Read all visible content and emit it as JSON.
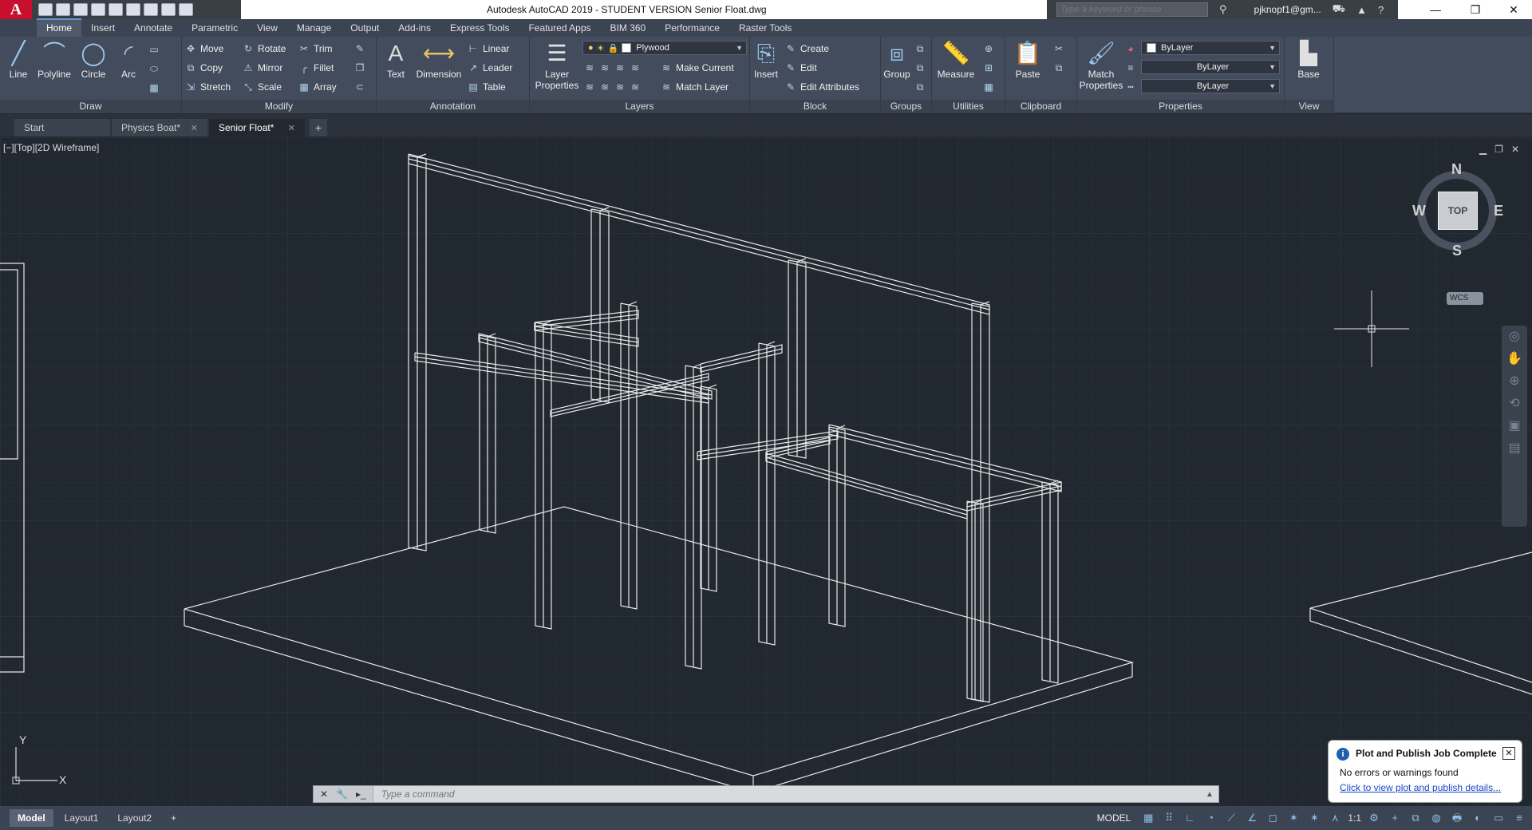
{
  "titlebar": {
    "title": "Autodesk AutoCAD 2019 - STUDENT VERSION    Senior Float.dwg",
    "logo_letter": "A",
    "search_placeholder": "Type a keyword or phrase",
    "user": "pjknopf1@gm...",
    "minimize": "—",
    "restore": "❐",
    "close": "✕"
  },
  "ribbon_tabs": [
    "Home",
    "Insert",
    "Annotate",
    "Parametric",
    "View",
    "Manage",
    "Output",
    "Add-ins",
    "Express Tools",
    "Featured Apps",
    "BIM 360",
    "Performance",
    "Raster Tools"
  ],
  "ribbon": {
    "draw": {
      "title": "Draw",
      "line": "Line",
      "polyline": "Polyline",
      "circle": "Circle",
      "arc": "Arc"
    },
    "modify": {
      "title": "Modify",
      "move": "Move",
      "rotate": "Rotate",
      "trim": "Trim",
      "copy": "Copy",
      "mirror": "Mirror",
      "fillet": "Fillet",
      "stretch": "Stretch",
      "scale": "Scale",
      "array": "Array"
    },
    "annotation": {
      "title": "Annotation",
      "text": "Text",
      "dimension": "Dimension",
      "linear": "Linear",
      "leader": "Leader",
      "table": "Table"
    },
    "layers": {
      "title": "Layers",
      "layer_properties": "Layer Properties",
      "current_layer": "Plywood",
      "make_current": "Make Current",
      "match_layer": "Match Layer"
    },
    "block": {
      "title": "Block",
      "insert": "Insert",
      "create": "Create",
      "edit": "Edit",
      "edit_attributes": "Edit Attributes"
    },
    "groups": {
      "title": "Groups",
      "group": "Group"
    },
    "utilities": {
      "title": "Utilities",
      "measure": "Measure"
    },
    "clipboard": {
      "title": "Clipboard",
      "paste": "Paste"
    },
    "properties": {
      "title": "Properties",
      "match_properties": "Match Properties",
      "color": "ByLayer",
      "linetype": "ByLayer",
      "lineweight": "ByLayer"
    },
    "view": {
      "title": "View",
      "base": "Base"
    }
  },
  "file_tabs": [
    {
      "label": "Start",
      "closable": false
    },
    {
      "label": "Physics Boat*",
      "closable": true
    },
    {
      "label": "Senior Float*",
      "closable": true,
      "active": true
    }
  ],
  "viewport": {
    "label": "[−][Top][2D Wireframe]",
    "viewcube": {
      "face": "TOP",
      "n": "N",
      "s": "S",
      "e": "E",
      "w": "W"
    },
    "wcs": "WCS",
    "ucs_x": "X",
    "ucs_y": "Y"
  },
  "command": {
    "placeholder": "Type a command"
  },
  "notification": {
    "title": "Plot and Publish Job Complete",
    "message": "No errors or warnings found",
    "link": "Click to view plot and publish details..."
  },
  "layout_tabs": [
    "Model",
    "Layout1",
    "Layout2"
  ],
  "status": {
    "model": "MODEL",
    "scale": "1:1"
  },
  "colors": {
    "accent": "#5a9bd5",
    "background": "#212830",
    "ribbon": "#434c5c",
    "wire": "#e8e8e8"
  }
}
